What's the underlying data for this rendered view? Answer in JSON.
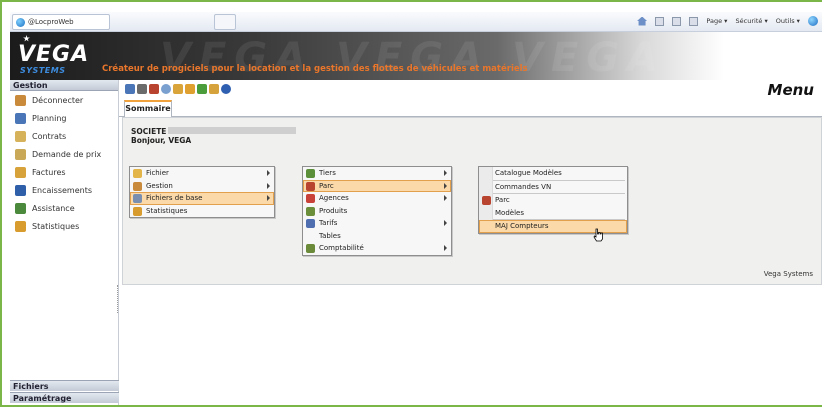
{
  "browser": {
    "tab_title": "@LocproWeb",
    "toolbar_items": [
      "Page ▾",
      "Sécurité ▾",
      "Outils ▾"
    ]
  },
  "banner": {
    "logo": "VEGA",
    "logo_sub": "SYSTEMS",
    "tagline": "Créateur de progiciels pour la location et la gestion des flottes de véhicules et matériels"
  },
  "sidebar": {
    "header": "Gestion",
    "items": [
      {
        "label": "Déconnecter",
        "icon": "door-icon",
        "color": "#c98a3b"
      },
      {
        "label": "Planning",
        "icon": "calendar-icon",
        "color": "#4a76b8"
      },
      {
        "label": "Contrats",
        "icon": "contract-icon",
        "color": "#d6b25a"
      },
      {
        "label": "Demande de prix",
        "icon": "quote-icon",
        "color": "#c9a957"
      },
      {
        "label": "Factures",
        "icon": "invoice-icon",
        "color": "#d8a23a"
      },
      {
        "label": "Encaissements",
        "icon": "money-icon",
        "color": "#2e5fa8"
      },
      {
        "label": "Assistance",
        "icon": "assistance-icon",
        "color": "#4b8a3c"
      },
      {
        "label": "Statistiques",
        "icon": "stats-icon",
        "color": "#d89b2d"
      }
    ],
    "footer_1": "Fichiers",
    "footer_2": "Paramétrage"
  },
  "main": {
    "title": "Menu",
    "tab": "Sommaire",
    "societe_label": "SOCIETE",
    "greeting": "Bonjour, VEGA",
    "footer": "Vega Systems",
    "toolbar_icons": [
      {
        "name": "planning-icon",
        "color": "#4a76b8"
      },
      {
        "name": "tools-icon",
        "color": "#6b6b6b"
      },
      {
        "name": "car-icon",
        "color": "#b8432f"
      },
      {
        "name": "search-icon",
        "color": "#7aa0cf"
      },
      {
        "name": "chat-icon",
        "color": "#d9a43a"
      },
      {
        "name": "user-icon",
        "color": "#e0a030"
      },
      {
        "name": "check-icon",
        "color": "#4b9c3b"
      },
      {
        "name": "document-icon",
        "color": "#d6a23c"
      },
      {
        "name": "help-icon",
        "color": "#2f5fb0"
      }
    ]
  },
  "menu1": {
    "items": [
      {
        "label": "Fichier",
        "icon": "folder-icon",
        "color": "#e3b448",
        "submenu": true
      },
      {
        "label": "Gestion",
        "icon": "gestion-icon",
        "color": "#c98a3b",
        "submenu": true
      },
      {
        "label": "Fichiers de base",
        "icon": "database-icon",
        "color": "#7a8fb0",
        "submenu": true,
        "highlighted": true
      },
      {
        "label": "Statistiques",
        "icon": "stats-icon",
        "color": "#d89b2d",
        "submenu": false
      }
    ]
  },
  "menu2": {
    "items": [
      {
        "label": "Tiers",
        "icon": "tiers-icon",
        "color": "#5b8f3a",
        "submenu": true
      },
      {
        "label": "Parc",
        "icon": "car-icon",
        "color": "#b8432f",
        "submenu": true,
        "highlighted": true
      },
      {
        "label": "Agences",
        "icon": "agency-icon",
        "color": "#c9423a",
        "submenu": true
      },
      {
        "label": "Produits",
        "icon": "product-icon",
        "color": "#6b8e3a",
        "submenu": false
      },
      {
        "label": "Tarifs",
        "icon": "price-icon",
        "color": "#4f6fb0",
        "submenu": true
      },
      {
        "label": "Tables",
        "icon": "",
        "color": "",
        "submenu": false
      },
      {
        "label": "Comptabilité",
        "icon": "accounting-icon",
        "color": "#6b8b3a",
        "submenu": true
      }
    ]
  },
  "menu3": {
    "items": [
      {
        "label": "Catalogue Modèles",
        "icon": "",
        "color": ""
      },
      {
        "label": "Commandes VN",
        "icon": "",
        "color": ""
      },
      {
        "label": "Parc",
        "icon": "car-icon",
        "color": "#b8432f"
      },
      {
        "label": "Modèles",
        "icon": "",
        "color": ""
      },
      {
        "label": "MAJ Compteurs",
        "icon": "",
        "color": "",
        "highlighted": true
      }
    ]
  }
}
